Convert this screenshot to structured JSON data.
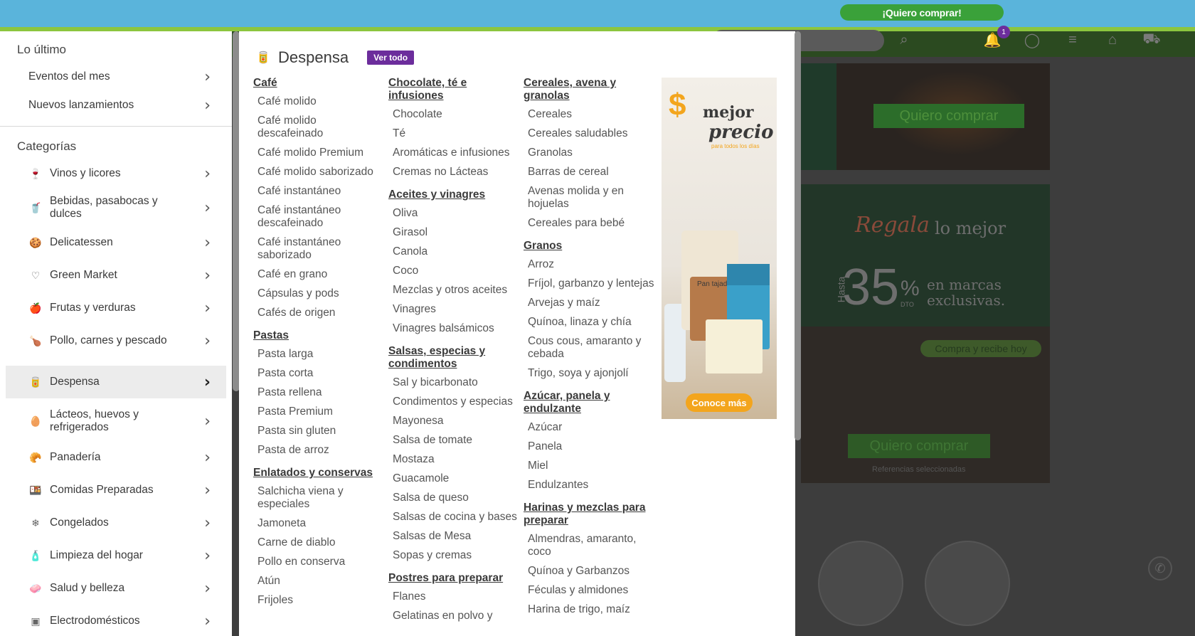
{
  "topbar": {
    "cta": "¡Quiero comprar!"
  },
  "header": {
    "notifications_count": "1"
  },
  "background_page": {
    "banner1_button": "Quiero comprar",
    "banner2": {
      "headline_script": "Regala",
      "headline_rest": "lo mejor",
      "hasta": "Hasta",
      "percent": "35",
      "percent_sign": "%",
      "dto": "DTO",
      "text": "en marcas exclusivas.",
      "pill": "Compra y recibe hoy",
      "button": "Quiero comprar",
      "note": "Referencias seleccionadas"
    }
  },
  "left_panel": {
    "latest_title": "Lo último",
    "latest_items": [
      {
        "label": "Eventos del mes"
      },
      {
        "label": "Nuevos lanzamientos"
      }
    ],
    "categories_title": "Categorías",
    "categories": [
      {
        "label": "Vinos y licores",
        "icon": "wine-glass-icon"
      },
      {
        "label": "Bebidas, pasabocas y dulces",
        "icon": "snacks-icon"
      },
      {
        "label": "Delicatessen",
        "icon": "cookie-icon"
      },
      {
        "label": "Green Market",
        "icon": "heart-icon"
      },
      {
        "label": "Frutas y verduras",
        "icon": "fruit-icon"
      },
      {
        "label": "Pollo, carnes y pescado",
        "icon": "drumstick-icon"
      },
      {
        "label": "Despensa",
        "icon": "pantry-icon",
        "active": true
      },
      {
        "label": "Lácteos, huevos y refrigerados",
        "icon": "egg-icon"
      },
      {
        "label": "Panadería",
        "icon": "bread-icon"
      },
      {
        "label": "Comidas Preparadas",
        "icon": "prepared-food-icon"
      },
      {
        "label": "Congelados",
        "icon": "frozen-icon"
      },
      {
        "label": "Limpieza del hogar",
        "icon": "cleaning-icon"
      },
      {
        "label": "Salud y belleza",
        "icon": "health-beauty-icon"
      },
      {
        "label": "Electrodomésticos",
        "icon": "appliance-icon"
      }
    ]
  },
  "mega_menu": {
    "title": "Despensa",
    "view_all": "Ver todo",
    "columns": [
      [
        {
          "title": "Café",
          "items": [
            "Café molido",
            "Café molido descafeinado",
            "Café molido Premium",
            "Café molido saborizado",
            "Café instantáneo",
            "Café instantáneo descafeinado",
            "Café instantáneo saborizado",
            "Café en grano",
            "Cápsulas y pods",
            "Cafés de origen"
          ]
        },
        {
          "title": "Pastas",
          "items": [
            "Pasta larga",
            "Pasta corta",
            "Pasta rellena",
            "Pasta Premium",
            "Pasta sin gluten",
            "Pasta de arroz"
          ]
        },
        {
          "title": "Enlatados y conservas",
          "items": [
            "Salchicha viena y especiales",
            "Jamoneta",
            "Carne de diablo",
            "Pollo en conserva",
            "Atún",
            "Frijoles"
          ]
        }
      ],
      [
        {
          "title": "Chocolate, té e infusiones",
          "items": [
            "Chocolate",
            "Té",
            "Aromáticas e infusiones",
            "Cremas no Lácteas"
          ]
        },
        {
          "title": "Aceites y vinagres",
          "items": [
            "Oliva",
            "Girasol",
            "Canola",
            "Coco",
            "Mezclas y otros aceites",
            "Vinagres",
            "Vinagres balsámicos"
          ]
        },
        {
          "title": "Salsas, especias y condimentos",
          "items": [
            "Sal y bicarbonato",
            "Condimentos y especias",
            "Mayonesa",
            "Salsa de tomate",
            "Mostaza",
            "Guacamole",
            "Salsa de queso",
            "Salsas de cocina y bases",
            "Salsas de Mesa",
            "Sopas y cremas"
          ]
        },
        {
          "title": "Postres para preparar",
          "items": [
            "Flanes",
            "Gelatinas en polvo y"
          ]
        }
      ],
      [
        {
          "title": "Cereales, avena y granolas",
          "items": [
            "Cereales",
            "Cereales saludables",
            "Granolas",
            "Barras de cereal",
            "Avenas molida y en hojuelas",
            "Cereales para bebé"
          ]
        },
        {
          "title": "Granos",
          "items": [
            "Arroz",
            "Fríjol, garbanzo y lentejas",
            "Arvejas y maíz",
            "Quínoa, linaza y chía",
            "Cous cous, amaranto y cebada",
            "Trigo, soya y ajonjolí"
          ]
        },
        {
          "title": "Azúcar, panela y endulzante",
          "items": [
            "Azúcar",
            "Panela",
            "Miel",
            "Endulzantes"
          ]
        },
        {
          "title": "Harinas y mezclas para preparar",
          "items": [
            "Almendras, amaranto, coco",
            "Quínoa y Garbanzos",
            "Féculas y almidones",
            "Harina de trigo, maíz"
          ]
        }
      ]
    ],
    "ad": {
      "dollar": "$",
      "line1": "mejor",
      "line2": "precio",
      "tagline": "para todos los días",
      "product": "Pan tajado",
      "button": "Conoce más"
    }
  }
}
